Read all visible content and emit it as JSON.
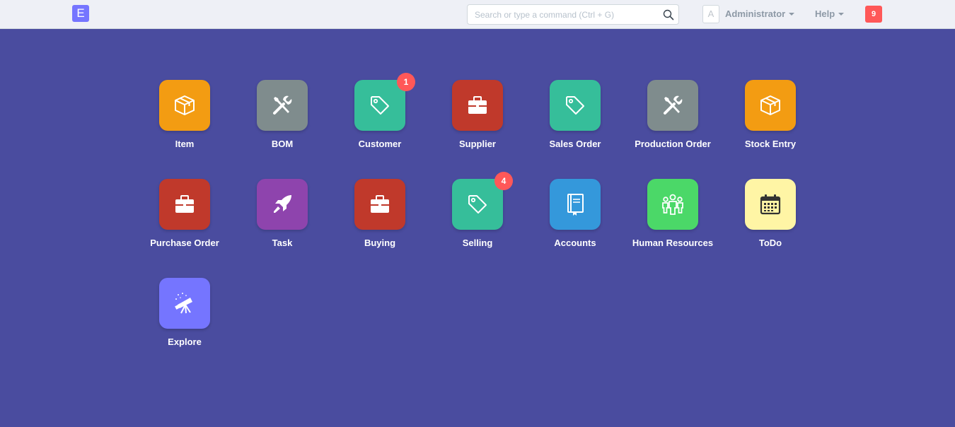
{
  "navbar": {
    "brand_letter": "E",
    "search": {
      "placeholder": "Search or type a command (Ctrl + G)",
      "value": ""
    },
    "avatar_letter": "A",
    "user_label": "Administrator",
    "help_label": "Help",
    "notification_count": "9"
  },
  "modules": [
    {
      "label": "Item",
      "icon": "box-icon",
      "color": "#f39c12"
    },
    {
      "label": "BOM",
      "icon": "tools-icon",
      "color": "#7f8c8d"
    },
    {
      "label": "Customer",
      "icon": "tag-icon",
      "color": "#36be9a",
      "badge": "1"
    },
    {
      "label": "Supplier",
      "icon": "briefcase-icon",
      "color": "#c0392b"
    },
    {
      "label": "Sales Order",
      "icon": "tag-icon",
      "color": "#36be9a"
    },
    {
      "label": "Production Order",
      "icon": "tools-icon",
      "color": "#7f8c8d"
    },
    {
      "label": "Stock Entry",
      "icon": "box-icon",
      "color": "#f39c12"
    },
    {
      "label": "Purchase Order",
      "icon": "briefcase-icon",
      "color": "#c0392b"
    },
    {
      "label": "Task",
      "icon": "rocket-icon",
      "color": "#8e44ad"
    },
    {
      "label": "Buying",
      "icon": "briefcase-icon",
      "color": "#c0392b"
    },
    {
      "label": "Selling",
      "icon": "tag-icon",
      "color": "#36be9a",
      "badge": "4"
    },
    {
      "label": "Accounts",
      "icon": "book-icon",
      "color": "#3498db"
    },
    {
      "label": "Human Resources",
      "icon": "people-icon",
      "color": "#4bd868"
    },
    {
      "label": "ToDo",
      "icon": "calendar-icon",
      "color": "#fff5a5"
    },
    {
      "label": "Explore",
      "icon": "telescope-icon",
      "color": "#7575ff"
    }
  ]
}
